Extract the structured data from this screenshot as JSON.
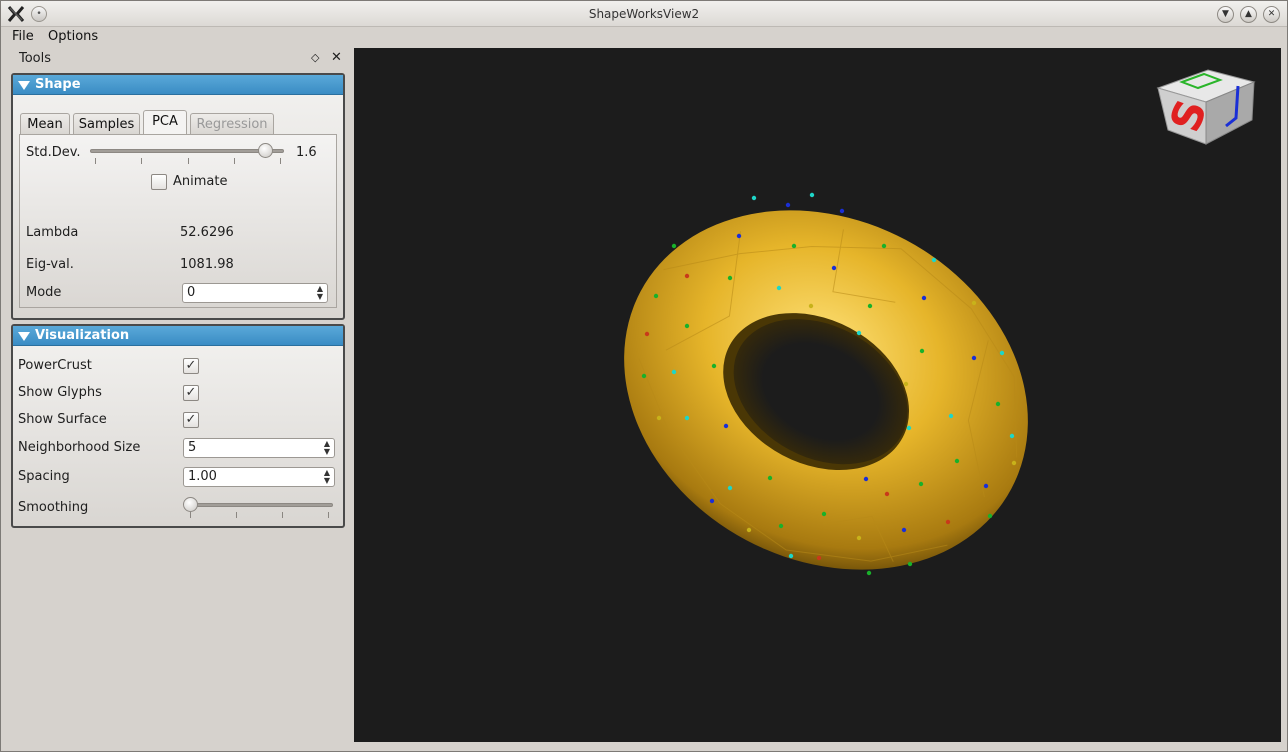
{
  "window": {
    "title": "ShapeWorksView2"
  },
  "menu": {
    "file": "File",
    "options": "Options"
  },
  "dock": {
    "title": "Tools"
  },
  "shape_group": {
    "title": "Shape",
    "tabs": [
      {
        "label": "Mean",
        "active": false,
        "enabled": true
      },
      {
        "label": "Samples",
        "active": false,
        "enabled": true
      },
      {
        "label": "PCA",
        "active": true,
        "enabled": true
      },
      {
        "label": "Regression",
        "active": false,
        "enabled": false
      }
    ],
    "stddev_label": "Std.Dev.",
    "stddev_value": "1.6",
    "stddev_fraction": 0.9,
    "animate_label": "Animate",
    "animate_checked": false,
    "lambda_label": "Lambda",
    "lambda_value": "52.6296",
    "eigval_label": "Eig-val.",
    "eigval_value": "1081.98",
    "mode_label": "Mode",
    "mode_value": "0"
  },
  "vis_group": {
    "title": "Visualization",
    "powercrust_label": "PowerCrust",
    "powercrust_checked": true,
    "glyphs_label": "Show Glyphs",
    "glyphs_checked": true,
    "surface_label": "Show Surface",
    "surface_checked": true,
    "neighborhood_label": "Neighborhood Size",
    "neighborhood_value": "5",
    "spacing_label": "Spacing",
    "spacing_value": "1.00",
    "smoothing_label": "Smoothing",
    "smoothing_fraction": 0.0
  },
  "viewport": {
    "background": "#1c1c1c",
    "surface_color": "#e6b52a",
    "cube_letter": "S"
  },
  "icons": {
    "close": "close-icon",
    "float": "float-icon",
    "check": "checkmark-icon",
    "spin": "spin-arrows-icon"
  }
}
